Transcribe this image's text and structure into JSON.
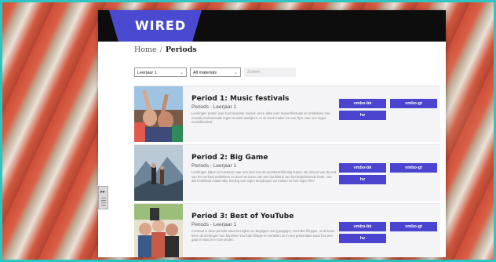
{
  "brand": {
    "logo": "WIRED"
  },
  "breadcrumb": {
    "home": "Home",
    "separator": "/",
    "current": "Periods"
  },
  "filters": {
    "year_select": "Leerjaar 1",
    "materials_select": "All materials",
    "search_placeholder": "Zoeken"
  },
  "periods": [
    {
      "title": "Period 1: Music festivals",
      "subtitle": "Periods - Leerjaar 1",
      "description": "Leerlingen praten over hun favoriete muziek, leren alles over muziekfestivals en ontdekken hoe muziek professionals tegen muziek aankijken. In de boek maken ze een flyer voor een eigen muziekfestival.",
      "tags": [
        "vmbo-bk",
        "vmbo-gt",
        "hv"
      ]
    },
    {
      "title": "Period 2: Big Game",
      "subtitle": "Periods - Leerjaar 1",
      "description": "Leerlingen kijken en luisteren naar een deel van de avonturenfilm Big Game. De inhoud van de rest van het verhaal ontdekken ze door het lezen van een hoofdstuk van het begeleidende boek. Van dat hoofdstuk maakt elke leerling een eigen storyboard. Zo maken ze hun eigen film!",
      "tags": [
        "vmbo-bk",
        "vmbo-gt",
        "hv"
      ]
    },
    {
      "title": "Period 3: Best of YouTube",
      "subtitle": "Periods - Leerjaar 1",
      "description": "Centraal in deze periode staat het kijken en begrijpen van (grappige) YouTube-filmpjes. In de boek leren de leerlingen hun favoriete YouTube-filmpje en vertellen ze in een presentatie waar het over gaat en wat ze er van vinden.",
      "tags": [
        "vmbo-bk",
        "vmbo-gt",
        "hv"
      ]
    }
  ],
  "side_handle": {
    "arrow": "▸▸"
  },
  "colors": {
    "accent": "#4a44cf",
    "topbar": "#0d0d0d",
    "border": "#2ec4c2"
  }
}
